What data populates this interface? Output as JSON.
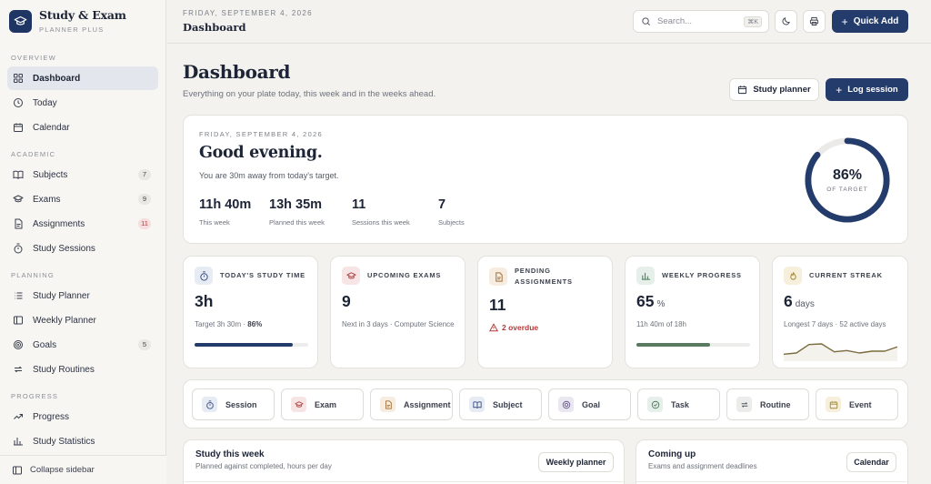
{
  "brand": {
    "title": "Study & Exam",
    "subtitle": "PLANNER PLUS"
  },
  "sidebar": {
    "sections": [
      {
        "label": "OVERVIEW",
        "items": [
          {
            "label": "Dashboard",
            "icon": "grid-icon",
            "active": true
          },
          {
            "label": "Today",
            "icon": "clock-icon"
          },
          {
            "label": "Calendar",
            "icon": "calendar-icon"
          }
        ]
      },
      {
        "label": "ACADEMIC",
        "items": [
          {
            "label": "Subjects",
            "icon": "book-icon",
            "badge": "7"
          },
          {
            "label": "Exams",
            "icon": "graduation-cap-icon",
            "badge": "9"
          },
          {
            "label": "Assignments",
            "icon": "document-icon",
            "badge": "11",
            "badge_alert": true
          },
          {
            "label": "Study Sessions",
            "icon": "stopwatch-icon"
          }
        ]
      },
      {
        "label": "PLANNING",
        "items": [
          {
            "label": "Study Planner",
            "icon": "list-icon"
          },
          {
            "label": "Weekly Planner",
            "icon": "columns-icon"
          },
          {
            "label": "Goals",
            "icon": "target-icon",
            "badge": "5"
          },
          {
            "label": "Study Routines",
            "icon": "repeat-icon"
          }
        ]
      },
      {
        "label": "PROGRESS",
        "items": [
          {
            "label": "Progress",
            "icon": "trend-icon"
          },
          {
            "label": "Study Statistics",
            "icon": "chart-icon"
          }
        ]
      }
    ],
    "collapse_label": "Collapse sidebar"
  },
  "topbar": {
    "date": "FRIDAY, SEPTEMBER 4, 2026",
    "title": "Dashboard",
    "search_placeholder": "Search...",
    "search_shortcut": "⌘K",
    "quick_add_label": "Quick Add"
  },
  "header": {
    "title": "Dashboard",
    "subtitle": "Everything on your plate today, this week and in the weeks ahead.",
    "study_planner_label": "Study planner",
    "log_session_label": "Log session"
  },
  "hero": {
    "date": "FRIDAY, SEPTEMBER 4, 2026",
    "greeting": "Good evening.",
    "away_text": "You are 30m away from today's target.",
    "stats": [
      {
        "value": "11h 40m",
        "label": "This week"
      },
      {
        "value": "13h 35m",
        "label": "Planned this week"
      },
      {
        "value": "11",
        "label": "Sessions this week"
      },
      {
        "value": "7",
        "label": "Subjects"
      }
    ],
    "target_percent": "86%",
    "target_fraction": 0.86,
    "target_label": "OF TARGET"
  },
  "stat_cards": {
    "study_time": {
      "title": "TODAY'S STUDY TIME",
      "value": "3h",
      "sub": "Target 3h 30m",
      "sub_strong": "86%",
      "progress": 0.86
    },
    "exams": {
      "title": "UPCOMING EXAMS",
      "value": "9",
      "sub": "Next in 3 days · Computer Science"
    },
    "assignments": {
      "title_line1": "PENDING",
      "title_line2": "ASSIGNMENTS",
      "value": "11",
      "overdue": "2 overdue"
    },
    "weekly": {
      "title": "WEEKLY PROGRESS",
      "value": "65",
      "unit": "%",
      "sub": "11h 40m of 18h",
      "progress": 0.65
    },
    "streak": {
      "title": "CURRENT STREAK",
      "value": "6",
      "unit": "days",
      "sub": "Longest 7 days · 52 active days",
      "sparkline": [
        1.0,
        1.2,
        2.6,
        2.7,
        1.4,
        1.6,
        1.2,
        1.5,
        1.5,
        2.2
      ]
    }
  },
  "quick_actions": [
    {
      "label": "Session",
      "icon": "stopwatch-icon",
      "tint": "#e7ebf3",
      "color": "#3d5488"
    },
    {
      "label": "Exam",
      "icon": "graduation-cap-icon",
      "tint": "#f7e4e4",
      "color": "#b04a4a"
    },
    {
      "label": "Assignment",
      "icon": "document-icon",
      "tint": "#f6ece0",
      "color": "#a0703a"
    },
    {
      "label": "Subject",
      "icon": "book-icon",
      "tint": "#e7ebf3",
      "color": "#3d5488"
    },
    {
      "label": "Goal",
      "icon": "target-icon",
      "tint": "#ebe7f1",
      "color": "#6a5a8c"
    },
    {
      "label": "Task",
      "icon": "check-circle-icon",
      "tint": "#e6efe9",
      "color": "#4a7a5a"
    },
    {
      "label": "Routine",
      "icon": "repeat-icon",
      "tint": "#ececea",
      "color": "#555a66"
    },
    {
      "label": "Event",
      "icon": "calendar-icon",
      "tint": "#f6efdc",
      "color": "#a08a3a"
    }
  ],
  "bottom": {
    "study_week": {
      "title": "Study this week",
      "subtitle": "Planned against completed, hours per day",
      "button": "Weekly planner"
    },
    "coming_up": {
      "title": "Coming up",
      "subtitle": "Exams and assignment deadlines",
      "button": "Calendar"
    }
  },
  "colors": {
    "accent": "#243c6b",
    "green": "#587a60",
    "danger": "#b23a3a"
  }
}
